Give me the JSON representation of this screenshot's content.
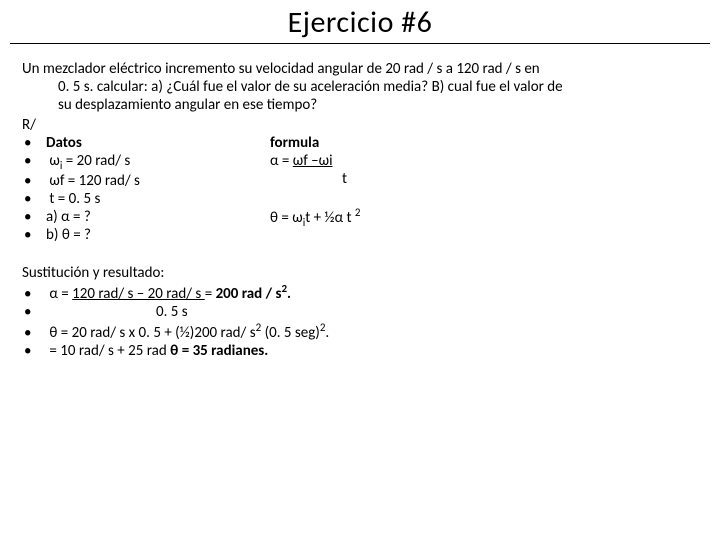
{
  "title": "Ejercicio #6",
  "problem": {
    "line1_lead": "Un mezclador eléctrico incremento su velocidad angular de 20 rad / s a 120 rad / s en",
    "line2": "0. 5 s. calcular: a) ¿Cuál fue el valor de su aceleración media?  B) cual fue el valor de",
    "line3": "su desplazamiento angular en ese tiempo?"
  },
  "r_label": "R/",
  "datos": {
    "header": "Datos",
    "items": [
      {
        "pre": " ω",
        "sub": "i",
        "post": " = 20 rad/ s"
      },
      {
        "pre": " ωf  = 120 rad/ s",
        "sub": "",
        "post": ""
      },
      {
        "pre": " t = 0. 5 s",
        "sub": "",
        "post": ""
      },
      {
        "pre": "a) α = ?",
        "sub": "",
        "post": ""
      },
      {
        "pre": "b) θ = ?",
        "sub": "",
        "post": ""
      }
    ]
  },
  "formula": {
    "header": "formula",
    "line1_pre": "α = ",
    "line1_u": "ωf –ωi    ",
    "line2": "t",
    "line3_pre": "θ = ω",
    "line3_sub1": "i",
    "line3_mid": "t + ½α t ",
    "line3_sup": "2"
  },
  "sustitucion": {
    "header": "Sustitución y resultado:",
    "items": [
      {
        "pre": "α =   ",
        "u": "120 rad/ s – 20 rad/ s ",
        "mid": " =  ",
        "bold": "200 rad / s",
        "sup": "2",
        "tail": "."
      },
      {
        "plain_indent": true,
        "text": "0. 5 s"
      },
      {
        "pre": "θ = 20 rad/ s x 0. 5 + (½)200 rad/ s",
        "sup1": "2",
        "mid2": " (0. 5 seg)",
        "sup2": "2",
        "tail": "."
      },
      {
        "pre": "  = 10 rad/ s + 25 rad ",
        "bold": "θ  = 35 radianes."
      }
    ]
  }
}
